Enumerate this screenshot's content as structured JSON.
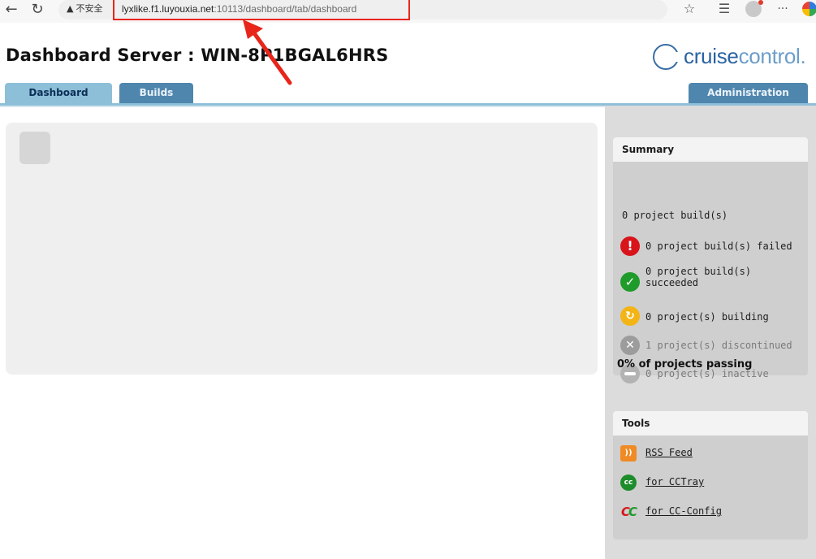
{
  "browser": {
    "security_label": "不安全",
    "url_host": "lyxlike.f1.luyouxia.net",
    "url_path": ":10113/dashboard/tab/dashboard",
    "icons": [
      "back-arrow-icon",
      "reload-icon",
      "warning-icon",
      "star-icon",
      "favorites-icon",
      "profile-avatar",
      "more-menu-icon",
      "edge-copilot-icon"
    ]
  },
  "header": {
    "title": "Dashboard Server : WIN-8P1BGAL6HRS",
    "logo_part1": "cruise",
    "logo_part2": "control",
    "logo_suffix": "."
  },
  "tabs": [
    {
      "label": "Dashboard",
      "active": true
    },
    {
      "label": "Builds",
      "active": false
    },
    {
      "label": "Administration",
      "active": false
    }
  ],
  "summary": {
    "heading": "Summary",
    "total": "0 project build(s)",
    "failed": "0 project build(s) failed",
    "succeeded_line1": "0 project build(s)",
    "succeeded_line2": "succeeded",
    "building": "0 project(s) building",
    "discontinued": "1 project(s) discontinued",
    "inactive": "0 project(s) inactive",
    "passing": "0% of projects passing"
  },
  "tools": {
    "heading": "Tools",
    "items": [
      {
        "label": "RSS Feed",
        "icon": "rss-icon"
      },
      {
        "label": "for CCTray",
        "icon": "cctray-icon"
      },
      {
        "label": "for CC-Config",
        "icon": "cc-config-icon"
      }
    ]
  },
  "colors": {
    "tab_active": "#8dbfd8",
    "tab_inactive": "#4f86ad",
    "annotation_red": "#e8251b",
    "failed_red": "#d8151b",
    "success_green": "#1e9b2a",
    "building_yellow": "#f3b416"
  }
}
